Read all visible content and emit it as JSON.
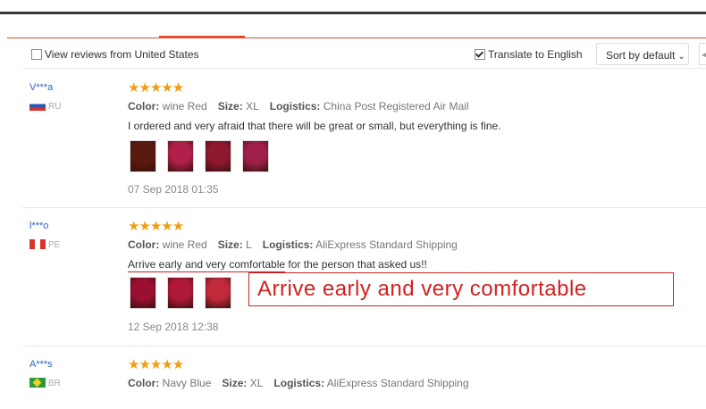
{
  "filter_bar": {
    "view_us_label": "View reviews from United States",
    "view_us_checked": false,
    "translate_label": "Translate to English",
    "translate_checked": true,
    "sort_label": "Sort by default"
  },
  "reviews": [
    {
      "user": "V***a",
      "country": "RU",
      "stars": "★★★★★",
      "color_label": "Color:",
      "color": "wine Red",
      "size_label": "Size:",
      "size": "XL",
      "logistics_label": "Logistics:",
      "logistics": "China Post Registered Air Mail",
      "text": "I ordered and very afraid that there will be great or small, but everything is fine.",
      "date": "07 Sep 2018 01:35",
      "photo_colors": [
        "#5a1a10",
        "#b0204a",
        "#8e1830",
        "#a0204a"
      ]
    },
    {
      "user": "l***o",
      "country": "PE",
      "stars": "★★★★★",
      "color_label": "Color:",
      "color": "wine Red",
      "size_label": "Size:",
      "size": "L",
      "logistics_label": "Logistics:",
      "logistics": "AliExpress Standard Shipping",
      "text_highlight": "Arrive early and very comfortable",
      "text_rest": " for the person that asked us!!",
      "date": "12 Sep 2018 12:38",
      "photo_colors": [
        "#9a1030",
        "#b01838",
        "#c02a3a"
      ]
    },
    {
      "user": "A***s",
      "country": "BR",
      "stars": "★★★★★",
      "color_label": "Color:",
      "color": "Navy Blue",
      "size_label": "Size:",
      "size": "XL",
      "logistics_label": "Logistics:",
      "logistics": "AliExpress Standard Shipping"
    }
  ],
  "callout": {
    "text": "Arrive early and very comfortable",
    "color": "#d42020"
  },
  "accent_color": "#e84a2c",
  "star_color": "#f39c12"
}
